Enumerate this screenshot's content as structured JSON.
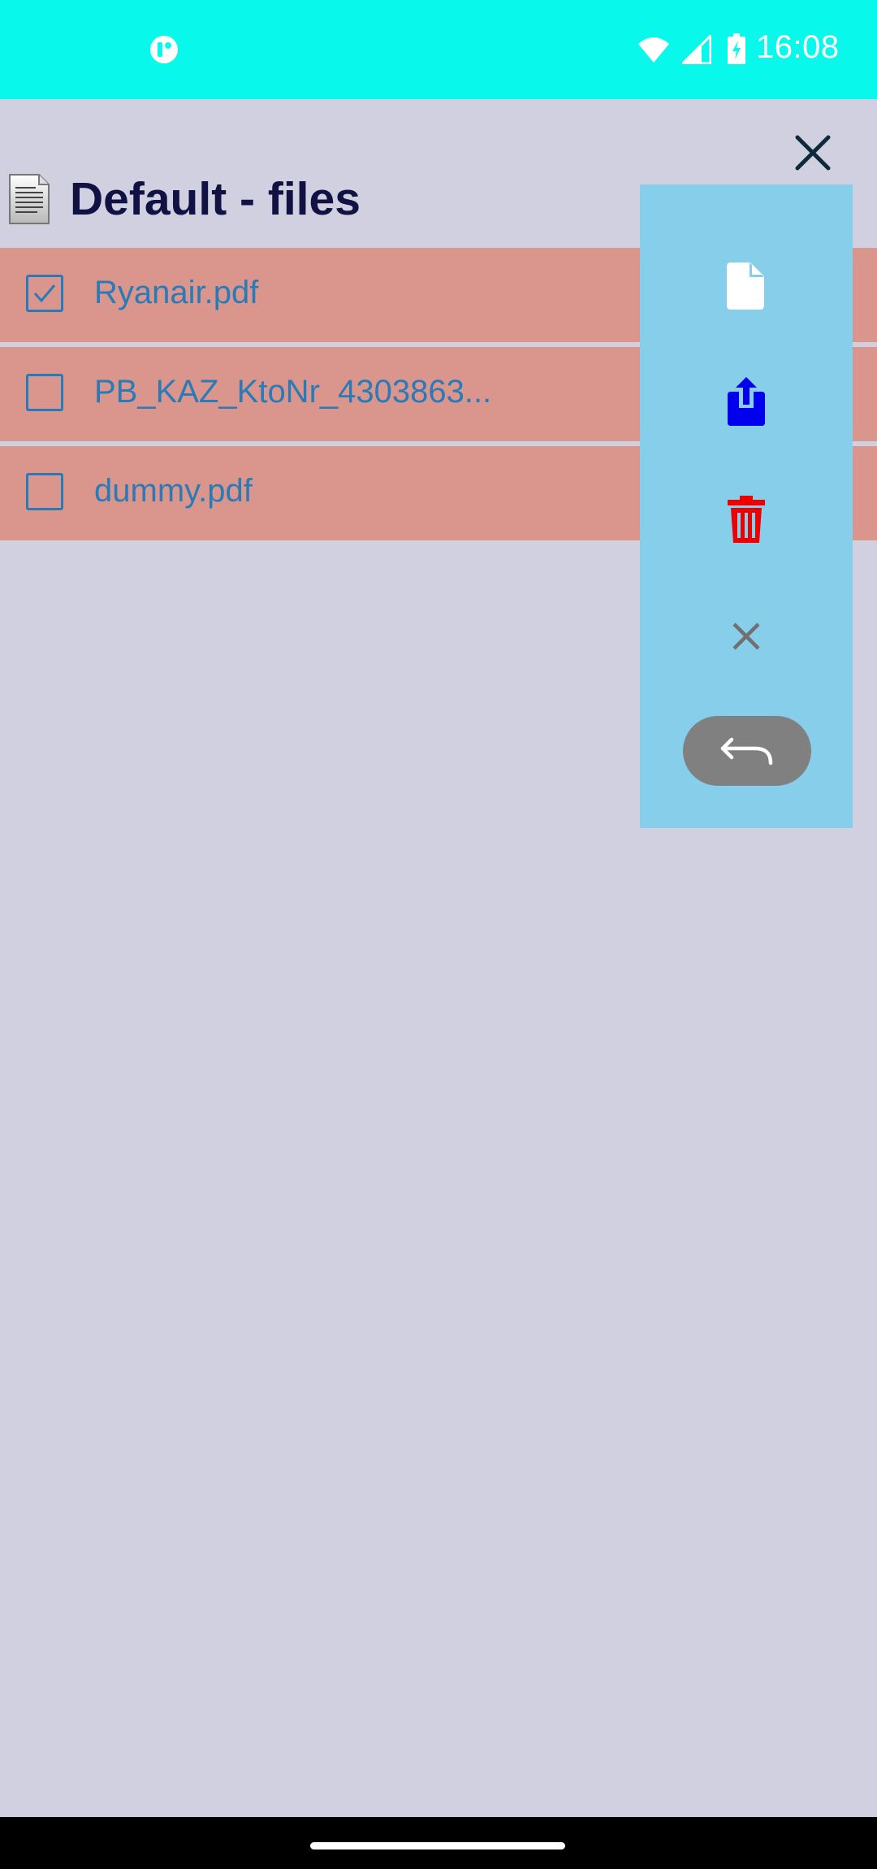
{
  "status_bar": {
    "time": "16:08",
    "icons": [
      "app-notification-icon",
      "wifi-icon",
      "cell-signal-icon",
      "battery-charging-icon"
    ]
  },
  "header": {
    "icon": "document-icon",
    "title": "Default - files"
  },
  "close_button": {
    "icon": "close-icon"
  },
  "files": [
    {
      "name": "Ryanair.pdf",
      "checked": true
    },
    {
      "name": "PB_KAZ_KtoNr_4303863...",
      "checked": false
    },
    {
      "name": "dummy.pdf",
      "checked": false
    }
  ],
  "action_panel": {
    "actions": [
      {
        "name": "new-file",
        "icon": "file-icon",
        "color": "#ffffff"
      },
      {
        "name": "share",
        "icon": "share-icon",
        "color": "#0000ee"
      },
      {
        "name": "delete",
        "icon": "trash-icon",
        "color": "#ee0000"
      },
      {
        "name": "cancel",
        "icon": "close-icon",
        "color": "#707070"
      },
      {
        "name": "back",
        "icon": "undo-arrow-icon",
        "color": "#808080"
      }
    ]
  },
  "colors": {
    "status_bar": "#08f9ec",
    "background": "#d0d0e0",
    "file_row": "#da968c",
    "file_text": "#2a7ab8",
    "title_text": "#111144",
    "panel": "#87ceeb"
  }
}
